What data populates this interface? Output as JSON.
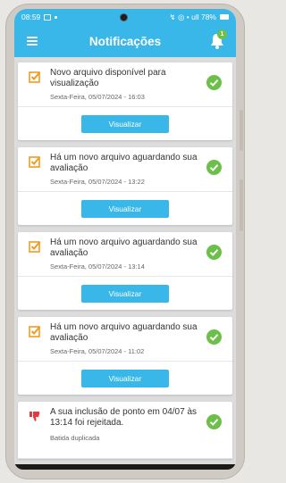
{
  "status_bar": {
    "time": "08:59",
    "right": "↯ ◎ • ull 78%"
  },
  "header": {
    "title": "Notificações",
    "badge_count": "1"
  },
  "notifications": [
    {
      "title": "Novo arquivo disponível para visualização",
      "date": "Sexta-Feira, 05/07/2024 - 16:03",
      "button": "Visualizar"
    },
    {
      "title": "Há um novo arquivo aguardando sua avaliação",
      "date": "Sexta-Feira, 05/07/2024 - 13:22",
      "button": "Visualizar"
    },
    {
      "title": "Há um novo arquivo aguardando sua avaliação",
      "date": "Sexta-Feira, 05/07/2024 - 13:14",
      "button": "Visualizar"
    },
    {
      "title": "Há um novo arquivo aguardando sua avaliação",
      "date": "Sexta-Feira, 05/07/2024 - 11:02",
      "button": "Visualizar"
    },
    {
      "title": "A sua inclusão de ponto em 04/07 às 13:14 foi rejeitada.",
      "note": "Batida duplicada"
    }
  ],
  "icons": {
    "menu": "menu-icon",
    "bell": "bell-icon",
    "check_square": "check-square-icon",
    "ok": "check-circle-icon",
    "thumbs_down": "thumbs-down-icon"
  },
  "colors": {
    "primary": "#39b7e9",
    "check_orange": "#f39a1e",
    "ok_green": "#6cc04a",
    "thumbs_red": "#e8383d"
  }
}
